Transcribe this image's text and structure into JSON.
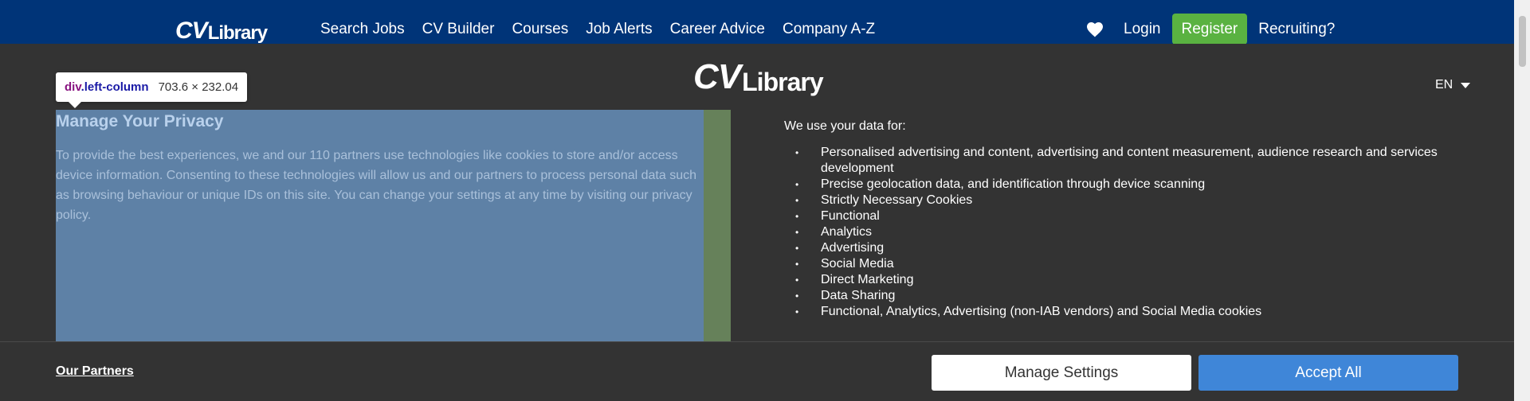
{
  "nav": {
    "logo": {
      "cv": "CV",
      "library": "Library"
    },
    "links": [
      "Search Jobs",
      "CV Builder",
      "Courses",
      "Job Alerts",
      "Career Advice",
      "Company A-Z"
    ],
    "login": "Login",
    "register": "Register",
    "recruiting": "Recruiting?",
    "heart_icon": "heart-icon"
  },
  "consent": {
    "logo": {
      "cv": "CV",
      "library": "Library"
    },
    "language": "EN",
    "devtools_tip": {
      "tag": "div",
      "class": ".left-column",
      "size": "703.6 × 232.04"
    },
    "title": "Manage Your Privacy",
    "description": "To provide the best experiences, we and our 110 partners use technologies like cookies to store and/or access device information. Consenting to these technologies will allow us and our partners to process personal data such as browsing behaviour or unique IDs on this site. You can change your settings at any time by visiting our privacy policy.",
    "data_heading": "We use your data for:",
    "purposes": [
      "Personalised advertising and content, advertising and content measurement, audience research and services development",
      "Precise geolocation data, and identification through device scanning",
      "Strictly Necessary Cookies",
      "Functional",
      "Analytics",
      "Advertising",
      "Social Media",
      "Direct Marketing",
      "Data Sharing",
      "Functional, Analytics, Advertising (non-IAB vendors) and Social Media cookies"
    ],
    "partners_link": "Our Partners",
    "manage_button": "Manage Settings",
    "accept_button": "Accept All"
  },
  "colors": {
    "nav_bg": "#003478",
    "register_green": "#5ab241",
    "accept_blue": "#3f86d8",
    "modal_bg": "#333333",
    "highlight_blue": "#5e81a6",
    "highlight_green": "#66815a"
  }
}
